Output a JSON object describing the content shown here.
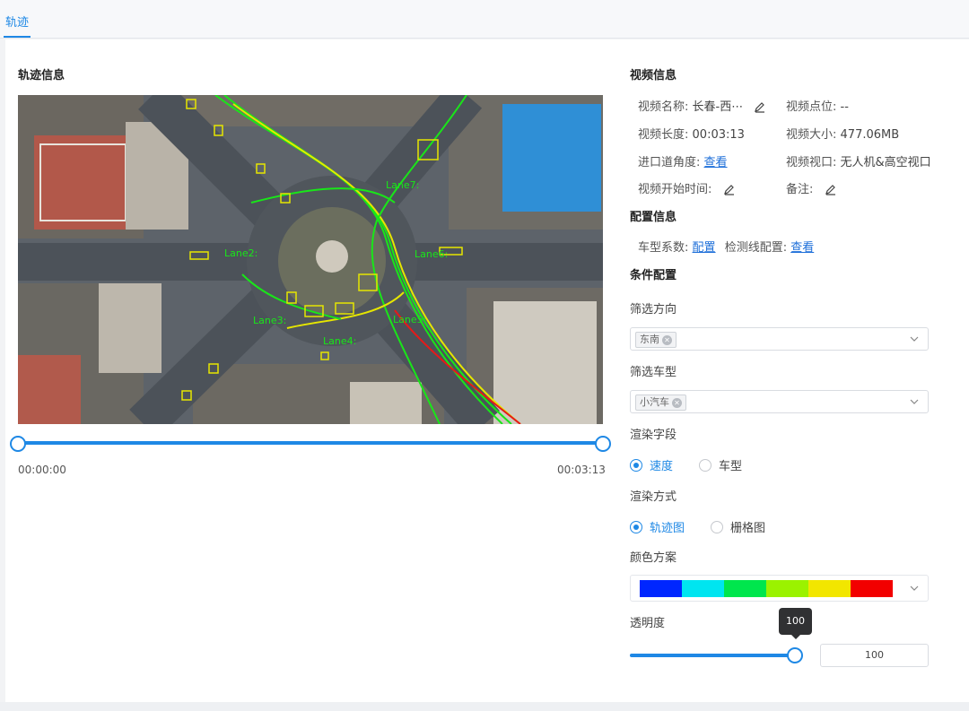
{
  "tabs": [
    {
      "label": "轨迹"
    }
  ],
  "trajectory_section": {
    "title": "轨迹信息"
  },
  "video_player": {
    "start_time": "00:00:00",
    "end_time": "00:03:13",
    "overlay_labels": [
      "Lane2:",
      "Lane3:",
      "Lane4:",
      "Lane5:",
      "Lane6:",
      "Lane7:"
    ]
  },
  "video_info": {
    "title": "视频信息",
    "name_label": "视频名称:",
    "name_value": "长春-西⋯",
    "point_label": "视频点位:",
    "point_value": "--",
    "length_label": "视频长度:",
    "length_value": "00:03:13",
    "size_label": "视频大小:",
    "size_value": "477.06MB",
    "angle_label": "进口道角度:",
    "angle_link": "查看",
    "view_label": "视频视口:",
    "view_value": "无人机&高空视口",
    "start_label": "视频开始时间:",
    "remark_label": "备注:"
  },
  "config_info": {
    "title": "配置信息",
    "vehicle_coef_label": "车型系数:",
    "vehicle_coef_link": "配置",
    "detect_line_label": "检测线配置:",
    "detect_line_link": "查看"
  },
  "condition_config": {
    "title": "条件配置",
    "direction_label": "筛选方向",
    "direction_tag": "东南",
    "vehicle_label": "筛选车型",
    "vehicle_tag": "小汽车",
    "render_field_label": "渲染字段",
    "render_field_options": [
      {
        "label": "速度",
        "selected": true
      },
      {
        "label": "车型",
        "selected": false
      }
    ],
    "render_mode_label": "渲染方式",
    "render_mode_options": [
      {
        "label": "轨迹图",
        "selected": true
      },
      {
        "label": "栅格图",
        "selected": false
      }
    ],
    "color_scheme_label": "颜色方案",
    "color_scheme": [
      "#0026ff",
      "#00e5f0",
      "#00e64d",
      "#9bf200",
      "#f2e600",
      "#f20000"
    ],
    "opacity_label": "透明度",
    "opacity_value": "100",
    "opacity_tooltip": "100"
  }
}
